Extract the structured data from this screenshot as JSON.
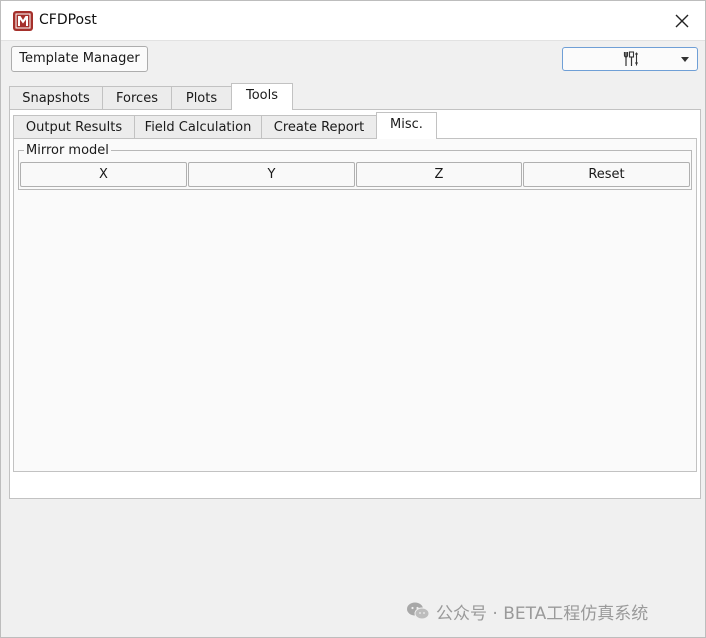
{
  "window": {
    "title": "CFDPost"
  },
  "toolbar": {
    "template_manager_label": "Template Manager",
    "tools_dropdown_icon": "tools-icon"
  },
  "tabs": [
    {
      "label": "Snapshots",
      "active": false
    },
    {
      "label": "Forces",
      "active": false
    },
    {
      "label": "Plots",
      "active": false
    },
    {
      "label": "Tools",
      "active": true
    }
  ],
  "subtabs": [
    {
      "label": "Output Results",
      "active": false
    },
    {
      "label": "Field Calculation",
      "active": false
    },
    {
      "label": "Create Report",
      "active": false
    },
    {
      "label": "Misc.",
      "active": true
    }
  ],
  "mirror_group": {
    "title": "Mirror model",
    "buttons": [
      "X",
      "Y",
      "Z",
      "Reset"
    ]
  },
  "watermark": {
    "text": "公众号 · BETA工程仿真系统"
  },
  "colors": {
    "app_icon": "#a5302b",
    "dropdown_border": "#6f9fd6"
  }
}
